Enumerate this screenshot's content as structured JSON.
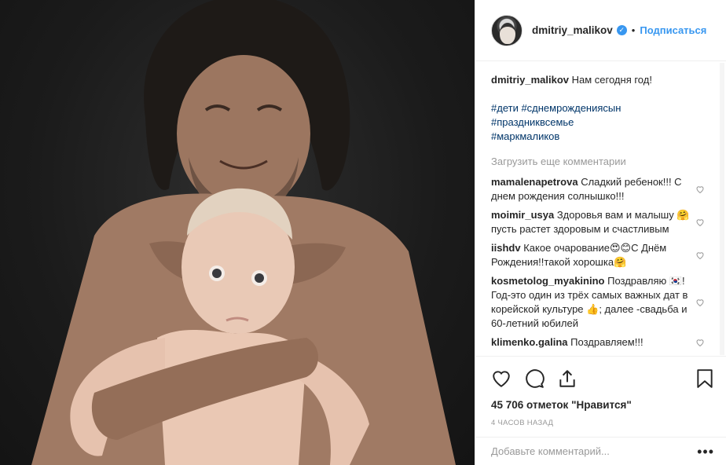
{
  "post": {
    "username": "dmitriy_malikov",
    "verified_icon": "verified-badge-icon",
    "separator": "•",
    "follow_label": "Подписаться"
  },
  "caption": {
    "username": "dmitriy_malikov",
    "text": "Нам сегодня год!",
    "hashtags": [
      "#дети #сднемрождениясын",
      "#праздниквсемье",
      "#маркмаликов"
    ]
  },
  "load_more": "Загрузить еще комментарии",
  "comments": [
    {
      "user": "mamalenapetrova",
      "text": "Сладкий ребенок!!! С днем рождения солнышко!!!"
    },
    {
      "user": "moimir_usya",
      "text": "Здоровья вам и малышу 🤗пусть растет здоровым и счастливым"
    },
    {
      "user": "iishdv",
      "text": "Какое очарование😍😊С Днём Рождения!!такой хорошка🤗"
    },
    {
      "user": "kosmetolog_myakinino",
      "text": "Поздравляю 🇰🇷! Год-это один из трёх самых важных дат в корейской культуре 👍; далее -свадьба и 60-летний юбилей"
    },
    {
      "user": "klimenko.galina",
      "text": "Поздравляем!!!"
    }
  ],
  "likes": "45 706 отметок \"Нравится\"",
  "timestamp": "4 часов назад",
  "add_comment_placeholder": "Добавьте комментарий...",
  "more_options": "•••",
  "colors": {
    "link_blue": "#3897f0",
    "hashtag_blue": "#003569",
    "muted": "#999999"
  }
}
